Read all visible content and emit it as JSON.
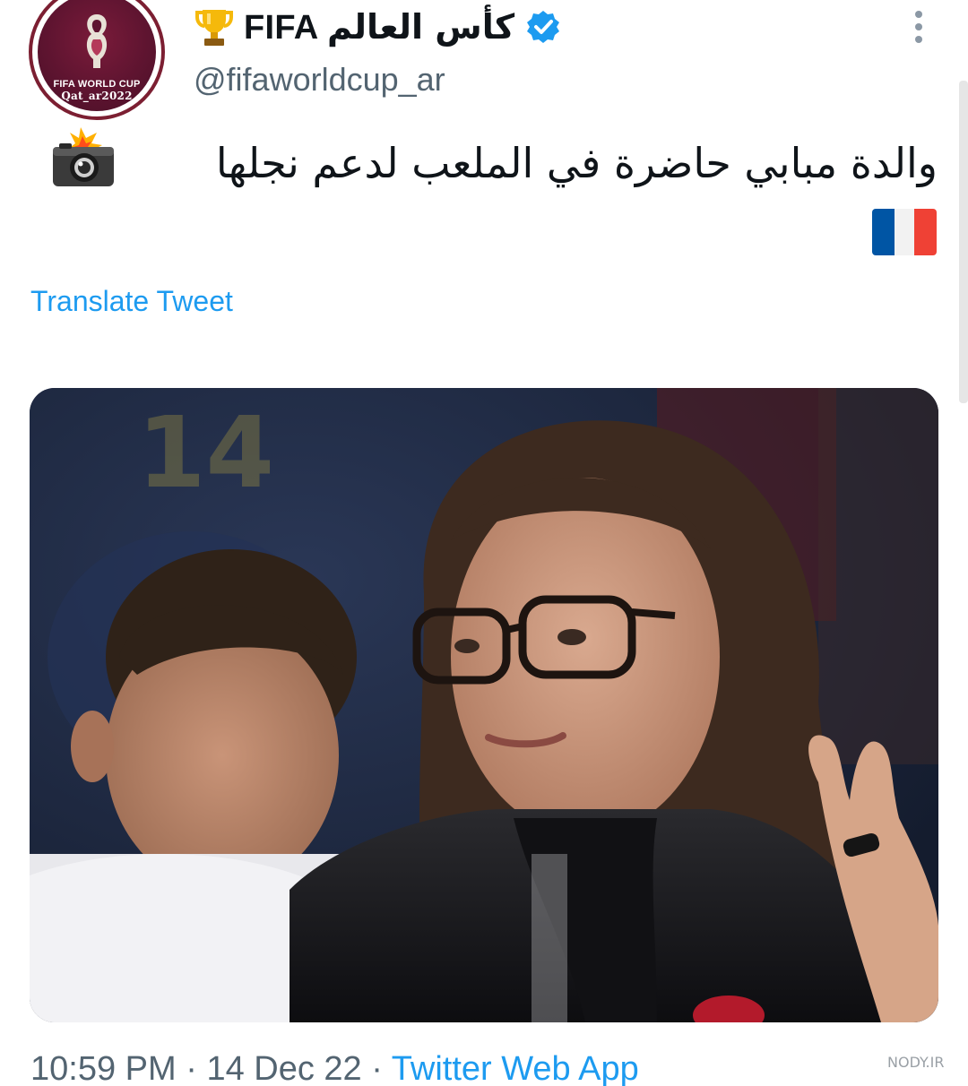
{
  "account": {
    "display_name_latin": "FIFA",
    "display_name_arabic": "كأس العالم",
    "handle": "@fifaworldcup_ar",
    "avatar_text_line1": "FIFA WORLD CUP",
    "avatar_text_line2": "Qat_ar2022",
    "icons": [
      "trophy-icon",
      "verified-icon",
      "more-icon"
    ]
  },
  "tweet": {
    "text": "والدة مبابي حاضرة في الملعب لدعم نجلها",
    "emojis": [
      "camera-with-flash-icon",
      "france-flag-icon"
    ],
    "translate_label": "Translate Tweet"
  },
  "meta": {
    "time": "10:59 PM",
    "date": "14 Dec 22",
    "separator": "·",
    "source": "Twitter Web App"
  },
  "watermark": {
    "text": "NODY.IR"
  },
  "colors": {
    "link": "#1d9bf0",
    "secondary_text": "#536471",
    "verified": "#1d9bf0",
    "avatar_bg": "#5e1430"
  }
}
